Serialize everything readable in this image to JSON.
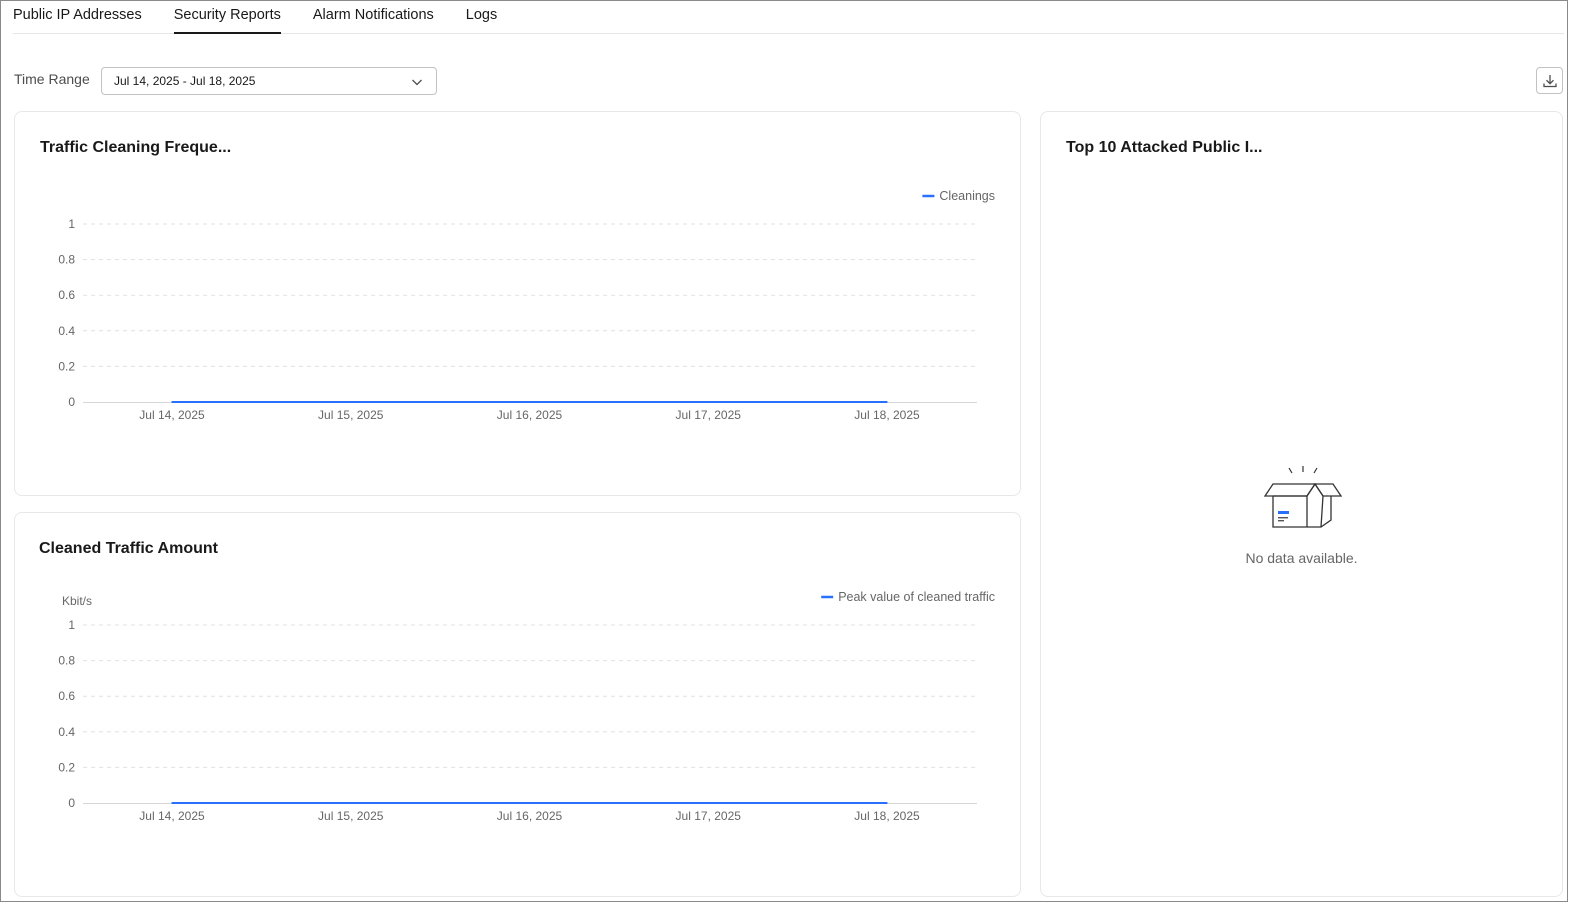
{
  "tabs": [
    {
      "label": "Public IP Addresses"
    },
    {
      "label": "Security Reports"
    },
    {
      "label": "Alarm Notifications"
    },
    {
      "label": "Logs"
    }
  ],
  "active_tab": "Security Reports",
  "time_range": {
    "label": "Time Range",
    "value": "Jul 14, 2025 - Jul 18, 2025"
  },
  "cards": {
    "cleaning_frequency": {
      "title": "Traffic Cleaning Freque..."
    },
    "cleaned_traffic": {
      "title": "Cleaned Traffic Amount"
    },
    "top_attacked": {
      "title": "Top 10 Attacked Public I...",
      "empty_text": "No data available."
    }
  },
  "colors": {
    "accent": "#2970ff",
    "grid": "#e0e0e0",
    "axis": "#d6d6d6"
  },
  "icons": {
    "dropdown": "chevron-down-icon",
    "download": "download-icon",
    "empty": "empty-box-icon"
  },
  "chart_data": [
    {
      "type": "line",
      "title": "",
      "x": [
        "Jul 14, 2025",
        "Jul 15, 2025",
        "Jul 16, 2025",
        "Jul 17, 2025",
        "Jul 18, 2025"
      ],
      "series": [
        {
          "name": "Cleanings",
          "values": [
            0,
            0,
            0,
            0,
            0
          ]
        }
      ],
      "yticks": [
        "0",
        "0.2",
        "0.4",
        "0.6",
        "0.8",
        "1"
      ],
      "ylim": [
        0,
        1
      ],
      "xlabel": "",
      "ylabel": "",
      "grid": true,
      "legend": "top-right"
    },
    {
      "type": "line",
      "title": "",
      "x": [
        "Jul 14, 2025",
        "Jul 15, 2025",
        "Jul 16, 2025",
        "Jul 17, 2025",
        "Jul 18, 2025"
      ],
      "series": [
        {
          "name": "Peak value of cleaned traffic",
          "values": [
            0,
            0,
            0,
            0,
            0
          ]
        }
      ],
      "yticks": [
        "0",
        "0.2",
        "0.4",
        "0.6",
        "0.8",
        "1"
      ],
      "ylim": [
        0,
        1
      ],
      "xlabel": "",
      "ylabel": "Kbit/s",
      "grid": true,
      "legend": "top-right"
    }
  ]
}
